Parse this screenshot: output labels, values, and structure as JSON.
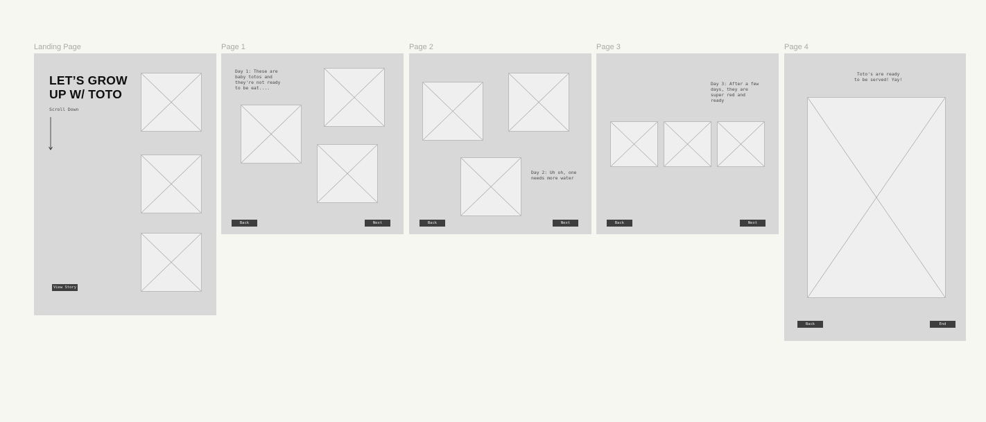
{
  "canvas": {
    "background": "#f5f7f0"
  },
  "frames": {
    "landing": {
      "label": "Landing Page",
      "title": "LET’S GROW\nUP W/ TOTO",
      "scroll_hint": "Scroll Down",
      "view_story_button": "View Story"
    },
    "page1": {
      "label": "Page 1",
      "text": "Day 1: These are\nbaby totos and\nthey're not ready\nto be eat....",
      "back_button": "Back",
      "next_button": "Next"
    },
    "page2": {
      "label": "Page 2",
      "text": "Day 2: Uh oh, one\nneeds more water",
      "back_button": "Back",
      "next_button": "Next"
    },
    "page3": {
      "label": "Page 3",
      "text": "Day 3: After a few\ndays, they are\nsuper red and\nready",
      "back_button": "Back",
      "next_button": "Next"
    },
    "page4": {
      "label": "Page 4",
      "text": "Toto's are ready\nto be served! Yay!",
      "back_button": "Back",
      "end_button": "End"
    }
  },
  "colors": {
    "frame_fill": "#d8d8d8",
    "placeholder_fill": "#efefef",
    "button_fill": "#3e3e3e",
    "label_text": "#a9aaa6"
  }
}
